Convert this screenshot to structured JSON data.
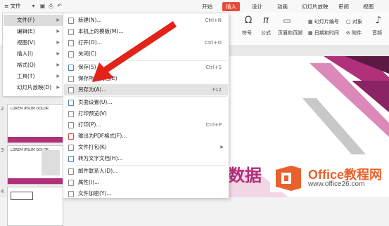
{
  "top_bar": {
    "file_label": "文件",
    "tabs": [
      "开始",
      "插入",
      "设计",
      "动画",
      "幻灯片放映",
      "审阅",
      "视图"
    ],
    "active_tab": "插入"
  },
  "ribbon": {
    "groups": [
      "符号",
      "公式",
      "页眉和页脚",
      "幻灯片编号",
      "日期和时间",
      "对象",
      "附件",
      "音频"
    ]
  },
  "left_menu": {
    "items": [
      {
        "label": "文件(F)",
        "has_arrow": true,
        "selected": true
      },
      {
        "label": "编辑(E)",
        "has_arrow": true
      },
      {
        "label": "视图(V)",
        "has_arrow": true
      },
      {
        "label": "插入(I)",
        "has_arrow": true
      },
      {
        "label": "格式(O)",
        "has_arrow": true
      },
      {
        "label": "工具(T)",
        "has_arrow": true
      },
      {
        "label": "幻灯片放映(D)",
        "has_arrow": true
      }
    ]
  },
  "file_menu": {
    "items": [
      {
        "label": "新建(N)...",
        "shortcut": "Ctrl+N"
      },
      {
        "label": "本机上的模板(M)...",
        "shortcut": ""
      },
      {
        "label": "打开(O)...",
        "shortcut": "Ctrl+O"
      },
      {
        "label": "关闭(C)",
        "shortcut": ""
      },
      {
        "label": "保存(S)",
        "shortcut": "Ctrl+S"
      },
      {
        "label": "保存所有文档(E)",
        "shortcut": ""
      },
      {
        "label": "另存为(A)...",
        "shortcut": "F12",
        "selected": true
      },
      {
        "label": "页面设置(U)...",
        "shortcut": ""
      },
      {
        "label": "打印预览(V)",
        "shortcut": ""
      },
      {
        "label": "打印(P)...",
        "shortcut": "Ctrl+P"
      },
      {
        "label": "输出为PDF格式(F)...",
        "shortcut": ""
      },
      {
        "label": "文件打包(K)",
        "shortcut": "",
        "submenu": true
      },
      {
        "label": "转为文字文档(H)...",
        "shortcut": ""
      },
      {
        "label": "邮件联系人(D)...",
        "shortcut": ""
      },
      {
        "label": "属性(I)...",
        "shortcut": ""
      },
      {
        "label": "文件加密(Y)...",
        "shortcut": ""
      }
    ]
  },
  "thumbnails": [
    {
      "number": "2",
      "title": "LOREM IPSUM DOLOR"
    },
    {
      "number": "3",
      "title": "LOREM IPSUM DOLOR"
    },
    {
      "number": "4",
      "title": ""
    }
  ],
  "slide": {
    "text": "数据"
  },
  "watermark": {
    "title": "Office教程网",
    "url": "www.office26.com"
  },
  "colors": {
    "accent": "#e84a3a",
    "watermark": "#e8612c",
    "slide_magenta": "#b0307a"
  }
}
